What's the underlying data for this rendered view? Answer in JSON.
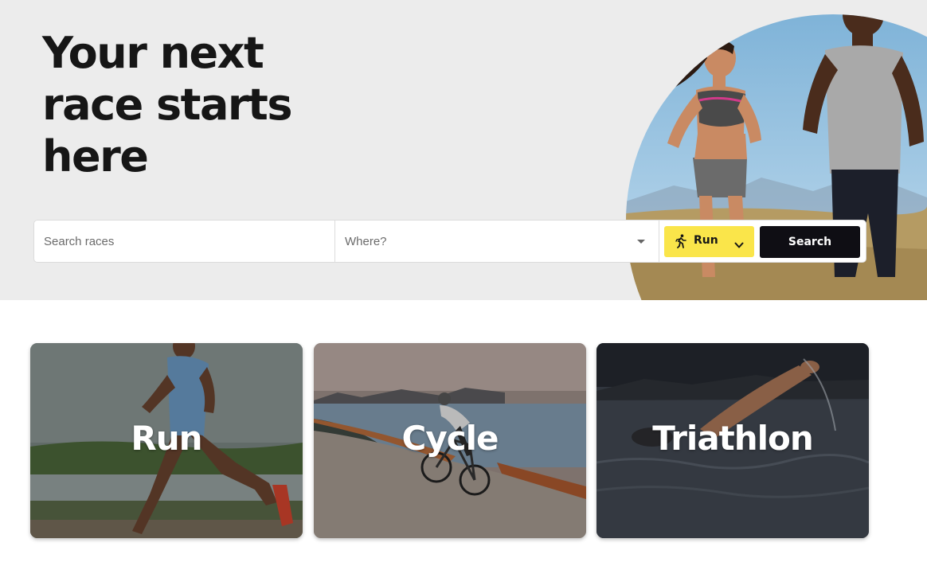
{
  "hero": {
    "title_lines": [
      "Your next",
      "race starts",
      "here"
    ],
    "image_alt": "Two runners jogging outdoors"
  },
  "search": {
    "races_placeholder": "Search races",
    "where_placeholder": "Where?",
    "sport_selected": "Run",
    "sport_icon": "running-person-icon",
    "button_label": "Search"
  },
  "categories": [
    {
      "label": "Run",
      "image": "runner-by-lake"
    },
    {
      "label": "Cycle",
      "image": "cyclist-coastal-road"
    },
    {
      "label": "Triathlon",
      "image": "open-water-swimmer"
    }
  ],
  "colors": {
    "hero_bg": "#ececec",
    "accent_yellow": "#fae54a",
    "search_button": "#0f0e14",
    "text_dark": "#161616"
  }
}
